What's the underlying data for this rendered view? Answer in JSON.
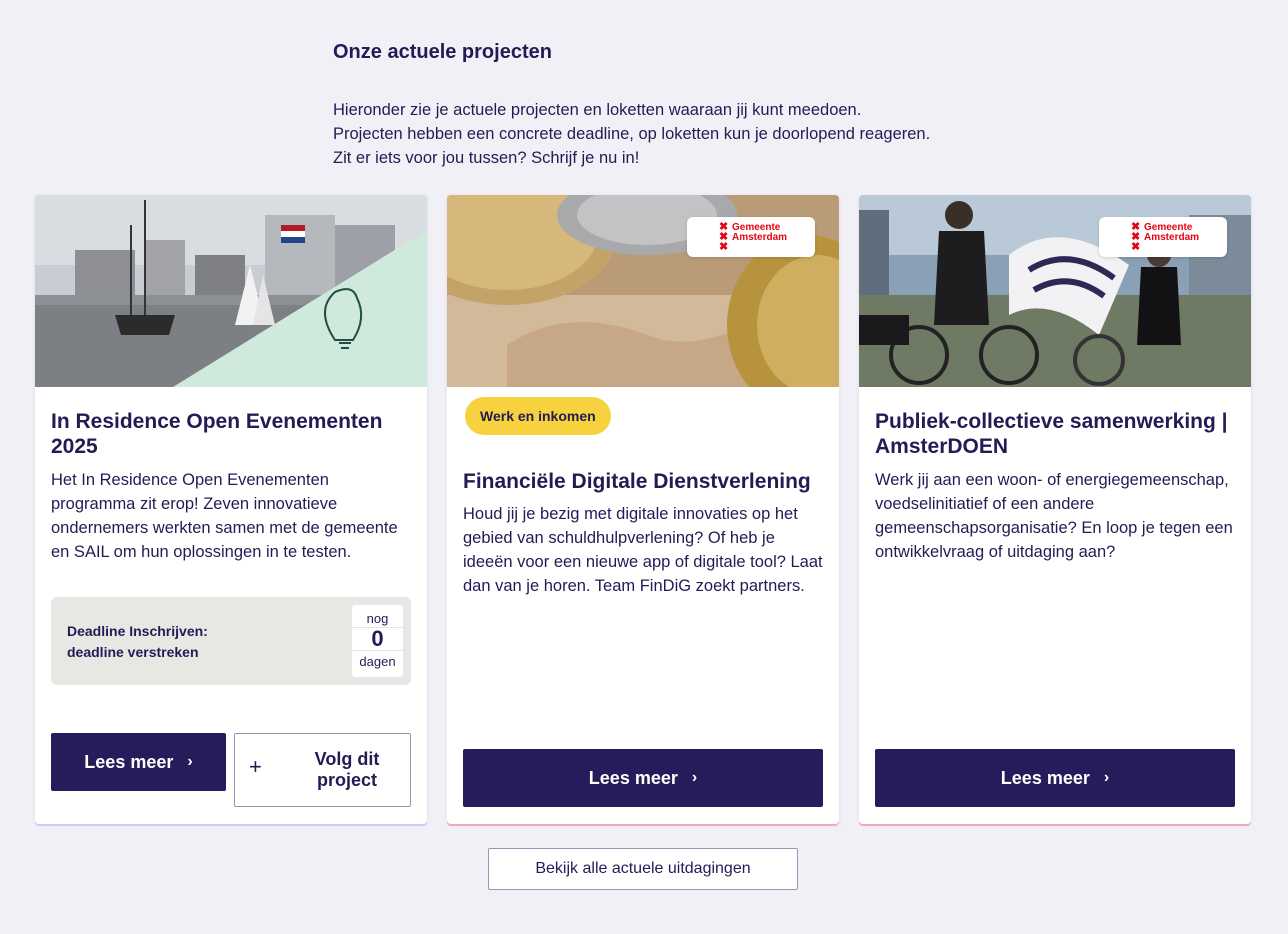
{
  "section": {
    "title": "Onze actuele projecten",
    "intro": "Hieronder zie je actuele projecten en loketten waaraan jij kunt meedoen. Projecten hebben een concrete deadline, op loketten kun je doorlopend reageren. Zit er iets voor jou tussen? Schrijf je nu in!"
  },
  "cards": [
    {
      "title": "In Residence Open Evenementen 2025",
      "description": "Het In Residence Open Evenementen programma zit erop! Zeven innovatieve ondernemers werkten samen met de gemeente en SAIL om hun oplossingen in te testen.",
      "deadline_label": "Deadline Inschrijven:",
      "deadline_status": "deadline verstreken",
      "counter_top": "nog",
      "counter_value": "0",
      "counter_bottom": "dagen",
      "read_more": "Lees meer",
      "follow": "Volg dit project",
      "image_icon": "lightbulb-icon"
    },
    {
      "tag": "Werk en inkomen",
      "title": "Financiële Digitale Dienstverlening",
      "description": "Houd jij je bezig met digitale innovaties op het gebied van schuldhulpverlening? Of heb je ideeën voor een nieuwe app of digitale tool? Laat dan van je horen. Team FinDiG zoekt partners.",
      "logo_line1": "Gemeente",
      "logo_line2": "Amsterdam",
      "read_more": "Lees meer"
    },
    {
      "title": "Publiek-collectieve samenwerking | AmsterDOEN",
      "description": "Werk jij aan een woon- of energiegemeenschap, voedselinitiatief of een andere gemeenschapsorganisatie? En loop je tegen een ontwikkelvraag of uitdaging aan?",
      "logo_line1": "Gemeente",
      "logo_line2": "Amsterdam",
      "read_more": "Lees meer"
    }
  ],
  "all_button": "Bekijk alle actuele uitdagingen",
  "colors": {
    "primary": "#261b5b",
    "tag": "#f8d13f",
    "background": "#f1f0f6",
    "logo_red": "#e30613"
  }
}
